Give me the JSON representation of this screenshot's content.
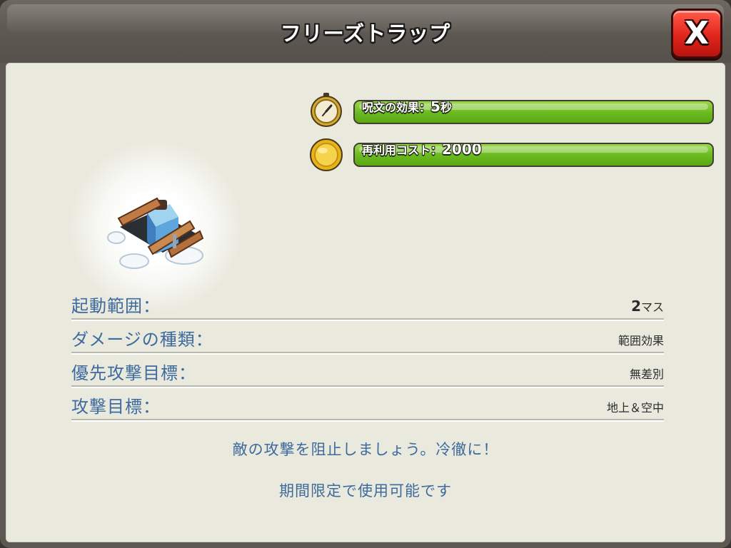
{
  "title": "フリーズトラップ",
  "close_label": "X",
  "stats": [
    {
      "icon": "stopwatch-icon",
      "label": "呪文の効果：",
      "value": "5",
      "unit": "秒"
    },
    {
      "icon": "gold-coin-icon",
      "label": "再利用コスト：",
      "value": "2000",
      "unit": ""
    }
  ],
  "info": [
    {
      "label": "起動範囲：",
      "value": "2",
      "unit": "マス"
    },
    {
      "label": "ダメージの種類：",
      "value": "範囲効果",
      "unit": ""
    },
    {
      "label": "優先攻撃目標：",
      "value": "無差別",
      "unit": ""
    },
    {
      "label": "攻撃目標：",
      "value": "地上＆空中",
      "unit": ""
    }
  ],
  "description": "敵の攻撃を阻止しましょう。冷徹に！",
  "availability": "期間限定で使用可能です",
  "colors": {
    "accent_blue": "#3e6a9d",
    "bar_green": "#6dbb22",
    "close_red": "#e2261d"
  }
}
